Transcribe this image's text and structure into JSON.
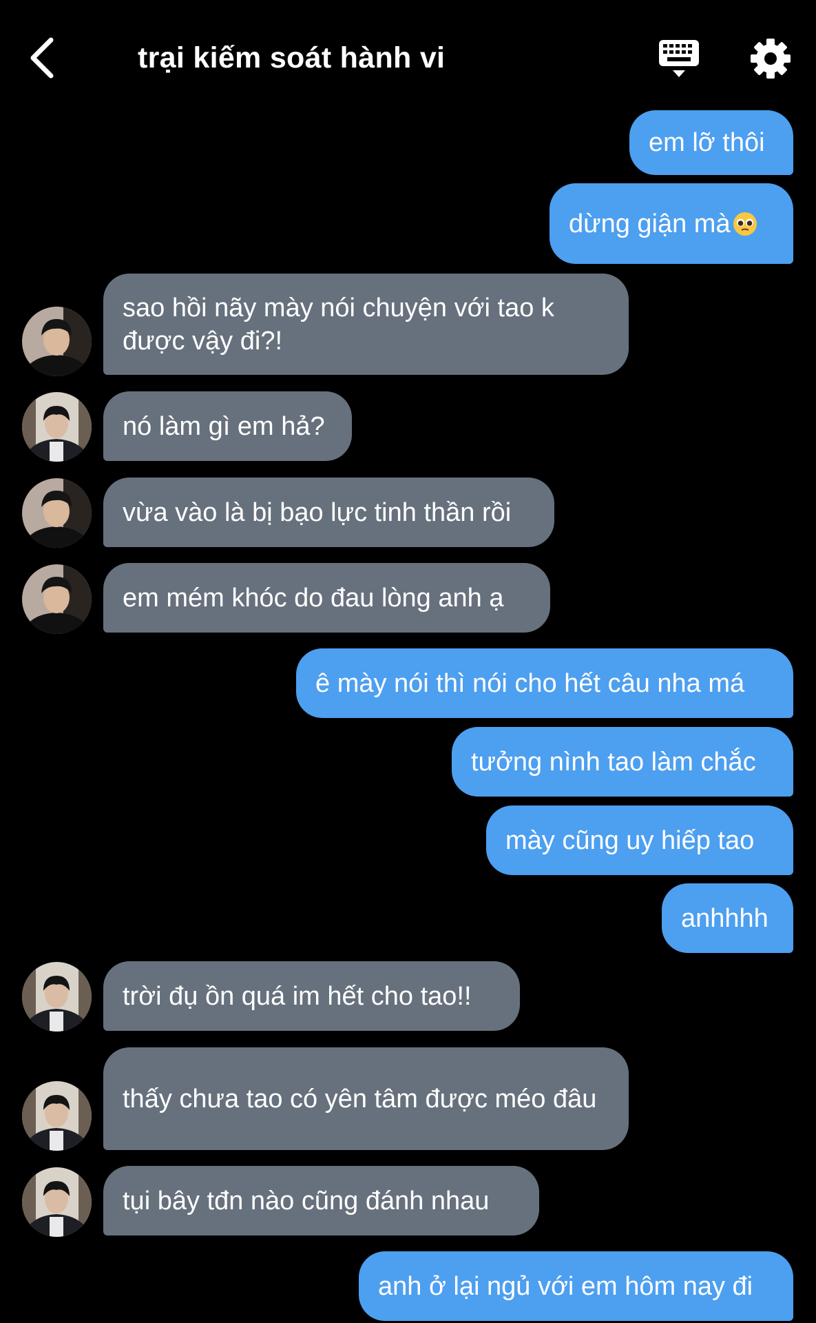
{
  "header": {
    "title": "trại kiếm soát hành vi",
    "back_icon": "chevron-left-icon",
    "keyboard_icon": "keyboard-icon",
    "settings_icon": "gear-icon"
  },
  "colors": {
    "background": "#000000",
    "outgoing_bubble": "#4d9ff0",
    "incoming_bubble": "#67717d",
    "text": "#ffffff"
  },
  "messages": [
    {
      "dir": "out",
      "text": "em lỡ thôi"
    },
    {
      "dir": "out",
      "text": "dừng giận mà",
      "emoji": "pleading-face"
    },
    {
      "dir": "in",
      "avatar": "A",
      "text": "sao hồi nãy mày nói chuyện với tao k được vậy đi?!"
    },
    {
      "dir": "in",
      "avatar": "B",
      "text": "nó làm gì em hả?"
    },
    {
      "dir": "in",
      "avatar": "A",
      "text": "vừa vào là bị bạo lực tinh thần rồi"
    },
    {
      "dir": "in",
      "avatar": "A",
      "text": "em mém khóc do đau lòng anh ạ"
    },
    {
      "dir": "out",
      "text": "ê mày nói thì nói cho hết câu nha má"
    },
    {
      "dir": "out",
      "text": "tưởng nình tao làm chắc"
    },
    {
      "dir": "out",
      "text": "mày cũng uy hiếp tao"
    },
    {
      "dir": "out",
      "text": "anhhhh"
    },
    {
      "dir": "in",
      "avatar": "B",
      "text": "trời đụ ồn quá im hết cho tao!!"
    },
    {
      "dir": "in",
      "avatar": "B",
      "text": "thấy chưa tao có yên tâm được méo đâu"
    },
    {
      "dir": "in",
      "avatar": "B",
      "text": "tụi bây tđn nào cũng đánh nhau"
    },
    {
      "dir": "out",
      "text": "anh ở lại ngủ với em hôm nay đi"
    }
  ]
}
